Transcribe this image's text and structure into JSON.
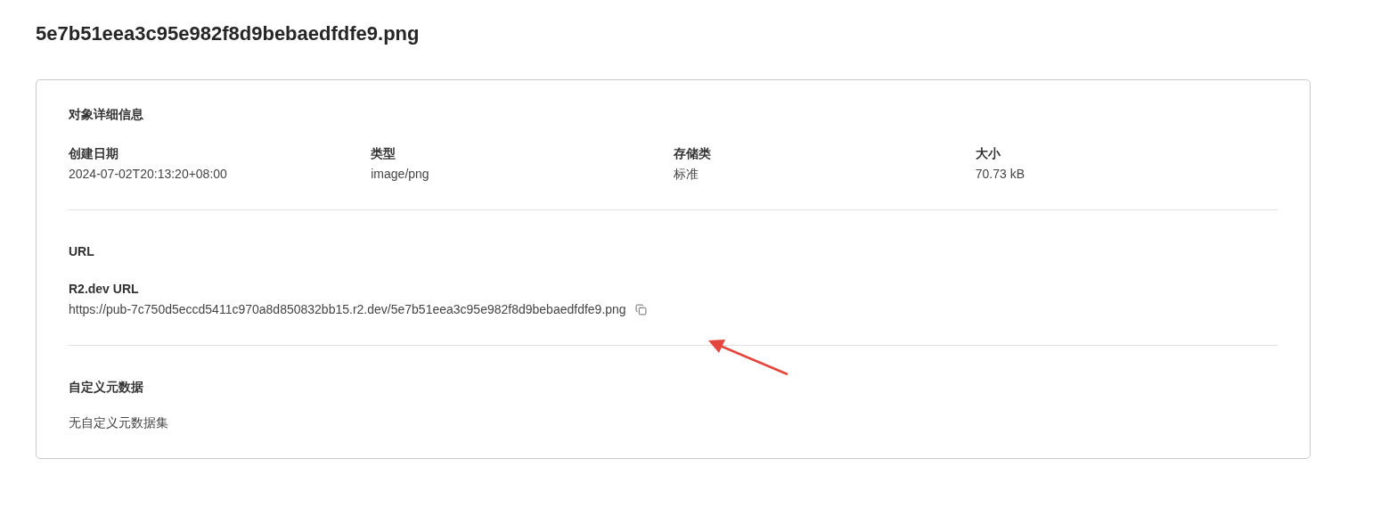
{
  "title": "5e7b51eea3c95e982f8d9bebaedfdfe9.png",
  "details": {
    "heading": "对象详细信息",
    "fields": [
      {
        "label": "创建日期",
        "value": "2024-07-02T20:13:20+08:00"
      },
      {
        "label": "类型",
        "value": "image/png"
      },
      {
        "label": "存储类",
        "value": "标准"
      },
      {
        "label": "大小",
        "value": "70.73 kB"
      }
    ]
  },
  "url_section": {
    "heading": "URL",
    "label": "R2.dev URL",
    "url": "https://pub-7c750d5eccd5411c970a8d850832bb15.r2.dev/5e7b51eea3c95e982f8d9bebaedfdfe9.png"
  },
  "metadata": {
    "heading": "自定义元数据",
    "empty_text": "无自定义元数据集"
  }
}
